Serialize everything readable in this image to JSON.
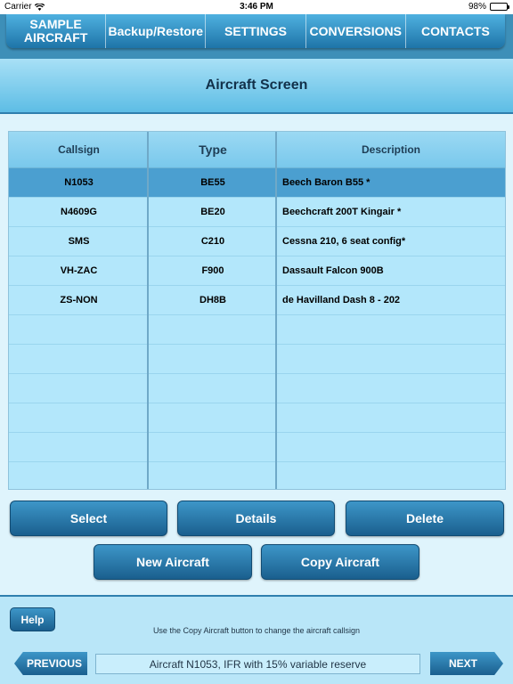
{
  "status_bar": {
    "carrier": "Carrier",
    "time": "3:46 PM",
    "battery": "98%"
  },
  "nav": {
    "items": [
      {
        "label": "SAMPLE\nAIRCRAFT"
      },
      {
        "label": "Backup/Restore"
      },
      {
        "label": "SETTINGS"
      },
      {
        "label": "CONVERSIONS"
      },
      {
        "label": "CONTACTS"
      }
    ]
  },
  "screen_title": "Aircraft Screen",
  "table": {
    "headers": {
      "callsign": "Callsign",
      "type": "Type",
      "description": "Description"
    },
    "rows": [
      {
        "callsign": "N1053",
        "type": "BE55",
        "description": "Beech Baron B55 *",
        "selected": true
      },
      {
        "callsign": "N4609G",
        "type": "BE20",
        "description": "Beechcraft 200T Kingair *"
      },
      {
        "callsign": "SMS",
        "type": "C210",
        "description": "Cessna 210, 6 seat config*"
      },
      {
        "callsign": "VH-ZAC",
        "type": "F900",
        "description": "Dassault Falcon 900B"
      },
      {
        "callsign": "ZS-NON",
        "type": "DH8B",
        "description": "de Havilland Dash 8 - 202"
      },
      {
        "callsign": "",
        "type": "",
        "description": ""
      },
      {
        "callsign": "",
        "type": "",
        "description": ""
      },
      {
        "callsign": "",
        "type": "",
        "description": ""
      },
      {
        "callsign": "",
        "type": "",
        "description": ""
      },
      {
        "callsign": "",
        "type": "",
        "description": ""
      },
      {
        "callsign": "",
        "type": "",
        "description": ""
      }
    ]
  },
  "buttons": {
    "select": "Select",
    "details": "Details",
    "delete": "Delete",
    "new_aircraft": "New Aircraft",
    "copy_aircraft": "Copy Aircraft"
  },
  "bottom": {
    "help": "Help",
    "hint": "Use the Copy Aircraft button to change the aircraft callsign",
    "previous": "PREVIOUS",
    "status": "Aircraft N1053, IFR with 15% variable reserve",
    "next": "NEXT"
  },
  "colors": {
    "accent": "#1e74a8",
    "selected_row": "#4b9fd0",
    "table_bg": "#b3e7fb"
  }
}
